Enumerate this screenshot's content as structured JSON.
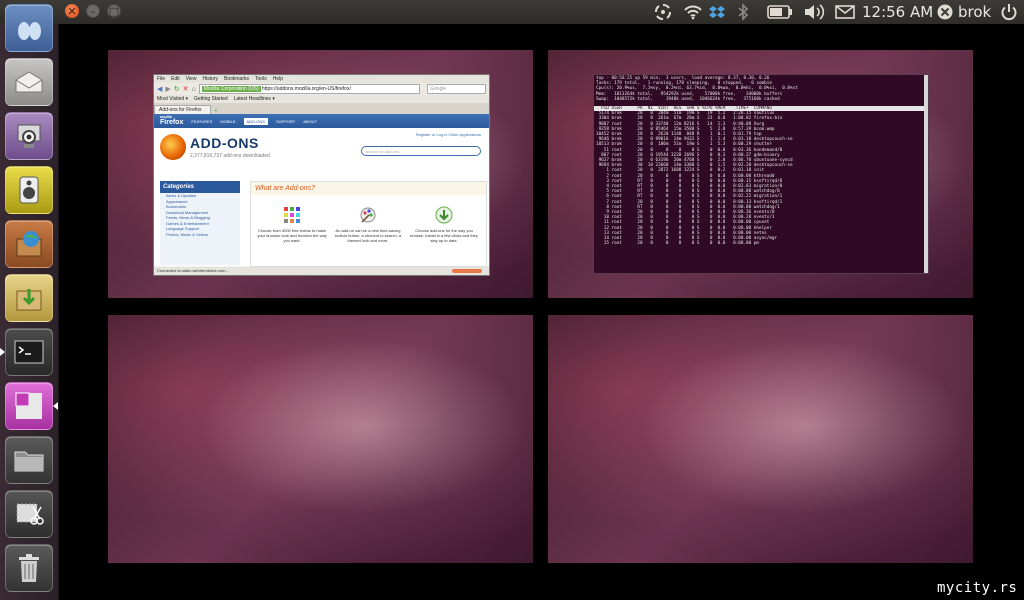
{
  "panel": {
    "clock": "12:56 AM",
    "user": "brok",
    "indicators": [
      "network-activity-icon",
      "wifi-icon",
      "dropbox-icon",
      "bluetooth-icon",
      "battery-icon",
      "volume-icon",
      "mail-icon"
    ]
  },
  "launcher": {
    "items": [
      "folder-partial",
      "mail",
      "webcam",
      "speaker",
      "software-center",
      "downloader",
      "terminal",
      "workspace-switcher",
      "files",
      "screenshot-tool",
      "trash"
    ]
  },
  "workspaces": {
    "firefox": {
      "menu": [
        "File",
        "Edit",
        "View",
        "History",
        "Bookmarks",
        "Tools",
        "Help"
      ],
      "identity": "Mozilla Corporation (US)",
      "url": "https://addons.mozilla.org/en-US/firefox/",
      "search_placeholder": "Google",
      "bookmarks": [
        "Most Visited ▾",
        "Getting Started",
        "Latest Headlines ▾"
      ],
      "tab": "Add-ons for Firefox",
      "site_nav": [
        "FEATURES",
        "MOBILE",
        "ADD-ONS",
        "SUPPORT",
        "ABOUT"
      ],
      "logo_small": "mozilla",
      "logo": "Firefox",
      "header_links": "Register or Log in     Other Applications",
      "search_box": "search for add-ons",
      "title": "ADD-ONS",
      "count": "2,377,816,737 add-ons downloaded",
      "categories_title": "Categories",
      "categories": [
        "Alerts & Updates",
        "Appearance",
        "Bookmarks",
        "Download Management",
        "Feeds, News & Blogging",
        "Games & Entertainment",
        "Language Support",
        "Photos, Music & Videos"
      ],
      "what_title": "What are Add-ons?",
      "features": [
        {
          "icon": "grid-icon",
          "text": "Choose from 5000 free extras to make your browser look and function the way you want."
        },
        {
          "icon": "paint-icon",
          "text": "An add-on can be a new time-saving toolbar button, a shortcut to search, a themed look and more."
        },
        {
          "icon": "download-arrow-icon",
          "text": "Choose add-ons for the way you browse. Install in a few clicks and they stay up to date."
        }
      ],
      "status": "Connected to static.webtrendslive.com..."
    },
    "terminal": {
      "summary": "top - 00:56:25 up 59 min,  3 users,  load average: 0.37, 0.30, 0.26\nTasks: 179 total,   1 running, 178 sleeping,   0 stopped,   0 zombie\nCpu(s): 20.9%us,  7.1%sy,  0.2%ni, 63.7%id,  0.0%wa,  0.0%hi,  0.0%si,  0.0%st\nMem:   1013264k total,   954292k used,    57000k free,    34000k buffers\nSwap:  1048572k total,     1948k used,  1046624k free,   375160k cached",
      "header": "  PID USER      PR  NI  VIRT  RES  SHR S %CPU %MEM    TIME+  COMMAND",
      "rows": [
        " 5174 brok      20   0  204m  51m  19m S   19  5.2   2:28.15 nautilus",
        " 3304 brok      20   0  261m  67m  28m S   23  6.8   1:08.82 firefox-bin",
        " 9807 root      20   0 33740  12m 8216 S   14  1.3   0:40.08 Xorg",
        " 9358 brok      20   0 85464  15m 3580 S    5  2.8   0:57.39 bcom.wmp",
        "10452 brok      20   0  2620 1148  848 R    1  0.1   0:01.79 top",
        " 9646 brok      20   0 99016  14m 9432 S    1  1.4   0:03.18 desktopcouch-se",
        "10513 brok      20   0  180m  51m  19m S    1  5.3   0:00.29 shutter",
        "   51 root      20   0     0    0    0 S    0  0.0   0:03.36 kondemand/0",
        "  807 root      20   0 19544 3228 2696 S    0  0.3   0:00.37 gdm-binary",
        " 9627 brok      20   0 63196  20m 4768 S    0  2.0   0:06.70 ubuntuone-syncd",
        " 9694 brok      30  10 23668  14m 3300 S    0  1.5   0:02.20 desktopcouch-se",
        "    1 root      20   0  2872 1688 1224 S    0  0.2   0:01.18 init",
        "    2 root      20   0     0    0    0 S    0  0.0   0:00.00 kthreadd",
        "    3 root      RT   0     0    0    0 S    0  0.0   0:00.15 ksoftirqd/0",
        "    4 root      RT   0     0    0    0 S    0  0.0   0:02.83 migration/0",
        "    5 root      RT   0     0    0    0 S    0  0.0   0:00.00 watchdog/0",
        "    6 root      RT   0     0    0    0 S    0  0.0   0:02.22 migration/1",
        "    7 root      20   0     0    0    0 S    0  0.0   0:00.13 ksoftirqd/1",
        "    8 root      RT   0     0    0    0 S    0  0.0   0:00.00 watchdog/1",
        "    9 root      20   0     0    0    0 S    0  0.0   0:00.36 events/0",
        "   10 root      20   0     0    0    0 S    0  0.0   0:00.28 events/1",
        "   11 root      20   0     0    0    0 S    0  0.0   0:00.00 cpuset",
        "   12 root      20   0     0    0    0 S    0  0.0   0:00.00 khelper",
        "   13 root      20   0     0    0    0 S    0  0.0   0:00.00 netns",
        "   14 root      20   0     0    0    0 S    0  0.0   0:00.00 async/mgr",
        "   15 root      20   0     0    0    0 S    0  0.0   0:00.00 pm"
      ]
    }
  },
  "watermark": "mycity.rs",
  "colors": {
    "ubuntu_orange": "#dd4814",
    "terminal_bg": "#300a24",
    "panel": "#3c3b37"
  }
}
